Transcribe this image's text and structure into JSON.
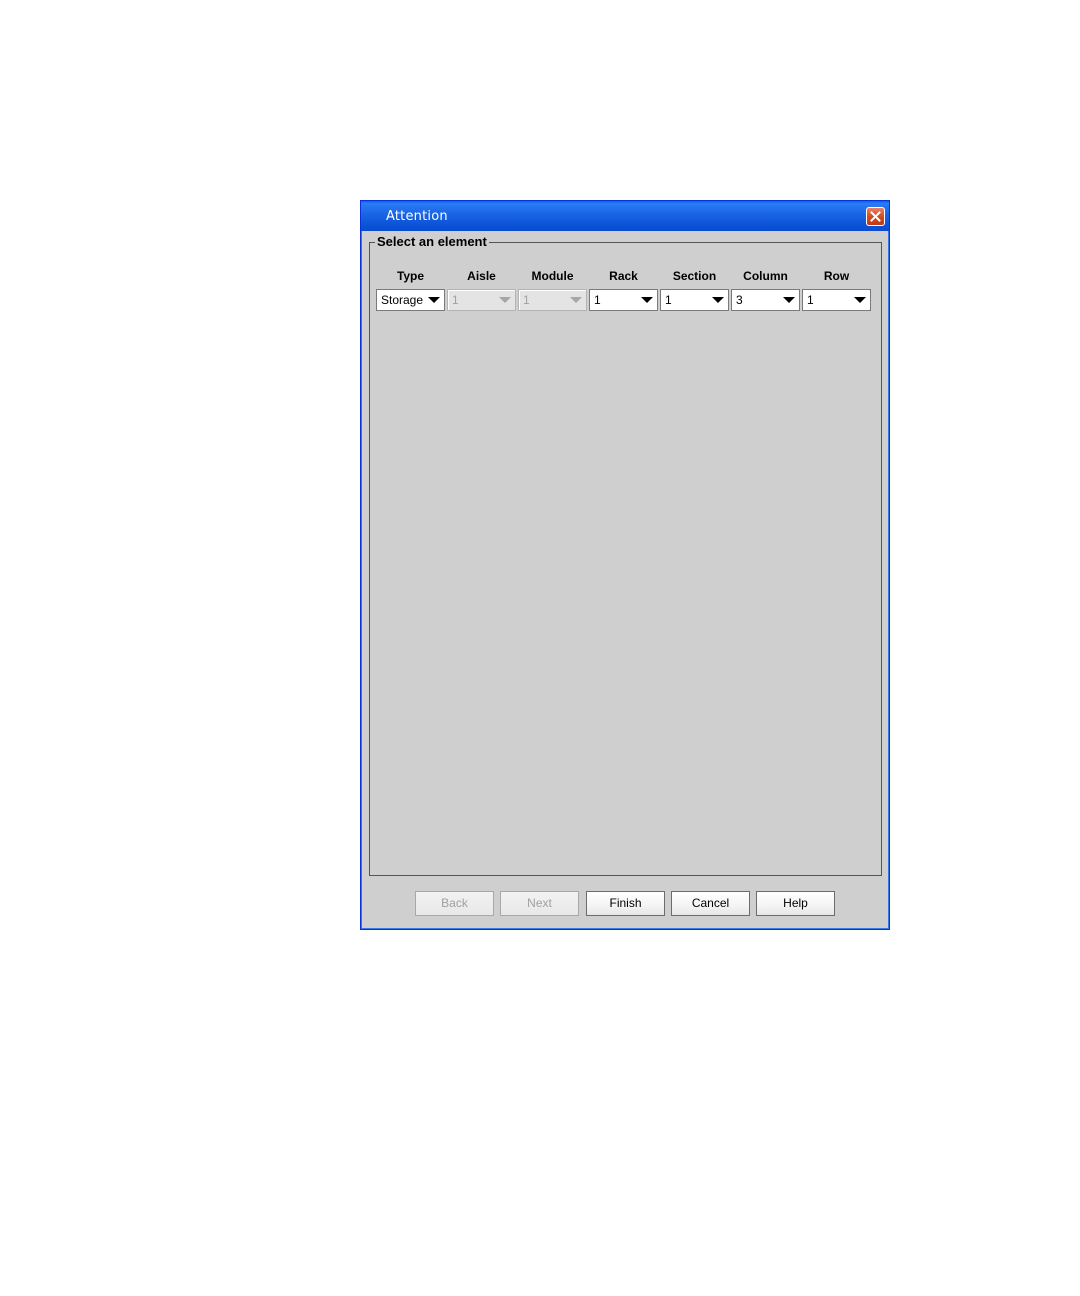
{
  "dialog": {
    "title": "Attention",
    "title_bar_color": "#0b53d8",
    "close_icon": "close-x-icon"
  },
  "group": {
    "legend": "Select an element"
  },
  "selectors": [
    {
      "key": "type",
      "header": "Type",
      "value": "Storage",
      "enabled": true
    },
    {
      "key": "aisle",
      "header": "Aisle",
      "value": "1",
      "enabled": false
    },
    {
      "key": "module",
      "header": "Module",
      "value": "1",
      "enabled": false
    },
    {
      "key": "rack",
      "header": "Rack",
      "value": "1",
      "enabled": true
    },
    {
      "key": "section",
      "header": "Section",
      "value": "1",
      "enabled": true
    },
    {
      "key": "column",
      "header": "Column",
      "value": "3",
      "enabled": true
    },
    {
      "key": "row",
      "header": "Row",
      "value": "1",
      "enabled": true
    }
  ],
  "buttons": {
    "back": {
      "label": "Back",
      "enabled": false
    },
    "next": {
      "label": "Next",
      "enabled": false
    },
    "finish": {
      "label": "Finish",
      "enabled": true
    },
    "cancel": {
      "label": "Cancel",
      "enabled": true
    },
    "help": {
      "label": "Help",
      "enabled": true
    }
  }
}
